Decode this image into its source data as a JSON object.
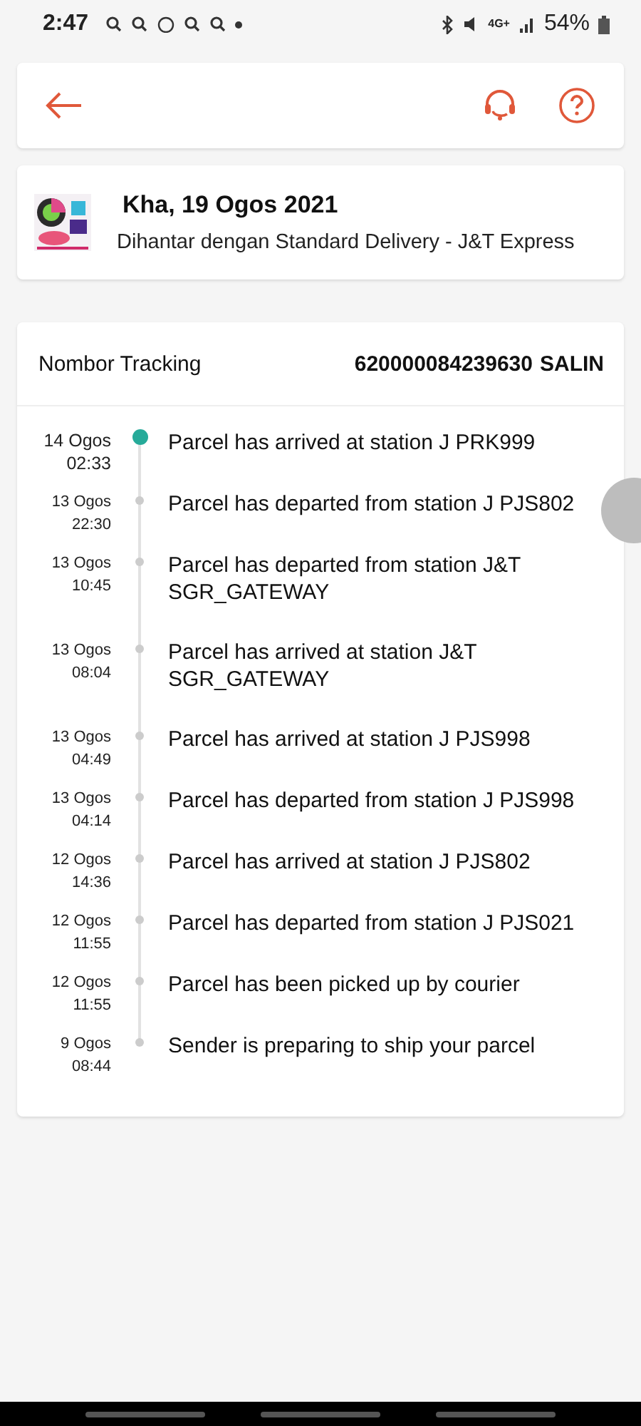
{
  "status_bar": {
    "time": "2:47",
    "network": "4G+",
    "battery": "54%"
  },
  "order": {
    "date": "Kha, 19 Ogos 2021",
    "shipping": "Dihantar dengan Standard Delivery  - J&T Express"
  },
  "tracking": {
    "label": "Nombor Tracking",
    "number": "620000084239630",
    "copy": "SALIN"
  },
  "events": [
    {
      "date": "14 Ogos",
      "time": "02:33",
      "text": "Parcel has arrived at station J PRK999",
      "current": true
    },
    {
      "date": "13 Ogos",
      "time": "22:30",
      "text": "Parcel has departed from station J PJS802",
      "current": false
    },
    {
      "date": "13 Ogos",
      "time": "10:45",
      "text": "Parcel has departed from station J&T SGR_GATEWAY",
      "current": false
    },
    {
      "date": "13 Ogos",
      "time": "08:04",
      "text": "Parcel has arrived at station J&T SGR_GATEWAY",
      "current": false
    },
    {
      "date": "13 Ogos",
      "time": "04:49",
      "text": "Parcel has arrived at station J PJS998",
      "current": false
    },
    {
      "date": "13 Ogos",
      "time": "04:14",
      "text": "Parcel has departed from station J PJS998",
      "current": false
    },
    {
      "date": "12 Ogos",
      "time": "14:36",
      "text": "Parcel has arrived at station J PJS802",
      "current": false
    },
    {
      "date": "12 Ogos",
      "time": "11:55",
      "text": "Parcel has departed from station J PJS021",
      "current": false
    },
    {
      "date": "12 Ogos",
      "time": "11:55",
      "text": "Parcel has been picked up by courier",
      "current": false
    },
    {
      "date": "9 Ogos",
      "time": "08:44",
      "text": "Sender is preparing to ship your parcel",
      "current": false
    }
  ]
}
